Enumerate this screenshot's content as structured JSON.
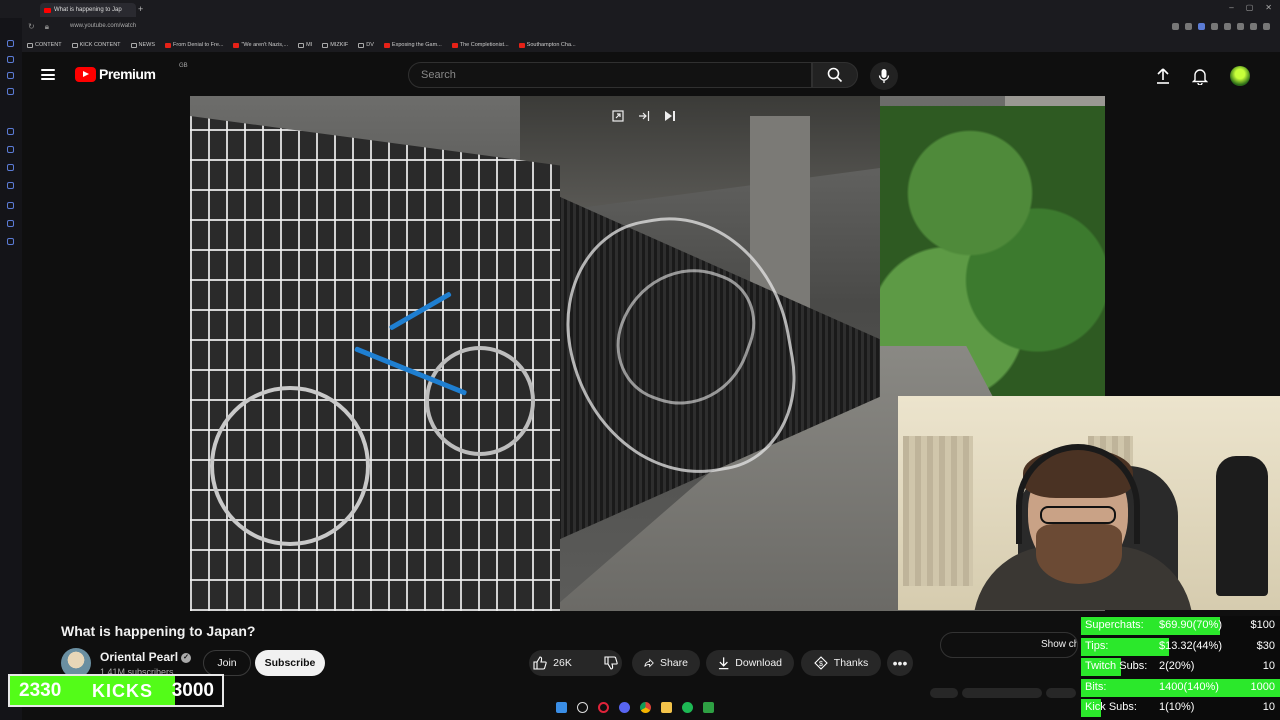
{
  "browser": {
    "tab_title": "What is happening to Jap",
    "url": "www.youtube.com/watch",
    "bookmarks": [
      {
        "label": "CONTENT",
        "icon": "folder-icon"
      },
      {
        "label": "KICK CONTENT",
        "icon": "folder-icon"
      },
      {
        "label": "NEWS",
        "icon": "folder-icon"
      },
      {
        "label": "From Denial to Fre...",
        "icon": "youtube-icon"
      },
      {
        "label": "\"We aren't Nazis,...",
        "icon": "site-icon"
      },
      {
        "label": "MI",
        "icon": "folder-icon"
      },
      {
        "label": "MIZKIF",
        "icon": "folder-icon"
      },
      {
        "label": "DV",
        "icon": "folder-icon"
      },
      {
        "label": "Exposing the Gam...",
        "icon": "youtube-icon"
      },
      {
        "label": "The Completionist...",
        "icon": "youtube-icon"
      },
      {
        "label": "Southampton Cha...",
        "icon": "youtube-icon"
      }
    ]
  },
  "header": {
    "logo_text": "Premium",
    "logo_region": "GB",
    "search_placeholder": "Search"
  },
  "video": {
    "title": "What is happening to Japan?",
    "channel_name": "Oriental Pearl",
    "channel_subs": "1.41M subscribers",
    "join_label": "Join",
    "subscribe_label": "Subscribe",
    "like_count": "26K",
    "share_label": "Share",
    "download_label": "Download",
    "thanks_label": "Thanks",
    "show_chat_label": "Show ch"
  },
  "kicks_goal": {
    "current": "2330",
    "label": "KICKS",
    "target": "3000",
    "progress": 0.777
  },
  "stream_goals": [
    {
      "label": "Superchats:",
      "value": "$69.90(70%)",
      "target": "$100",
      "progress": 0.7
    },
    {
      "label": "Tips:",
      "value": "$13.32(44%)",
      "target": "$30",
      "progress": 0.44
    },
    {
      "label": "Twitch Subs:",
      "value": "2(20%)",
      "target": "10",
      "progress": 0.2
    },
    {
      "label": "Bits:",
      "value": "1400(140%)",
      "target": "1000",
      "progress": 1.0
    },
    {
      "label": "Kick Subs:",
      "value": "1(10%)",
      "target": "10",
      "progress": 0.1
    }
  ],
  "colors": {
    "youtube_red": "#ff0000",
    "kick_green": "#53fc18",
    "goal_green": "#2be82b"
  }
}
